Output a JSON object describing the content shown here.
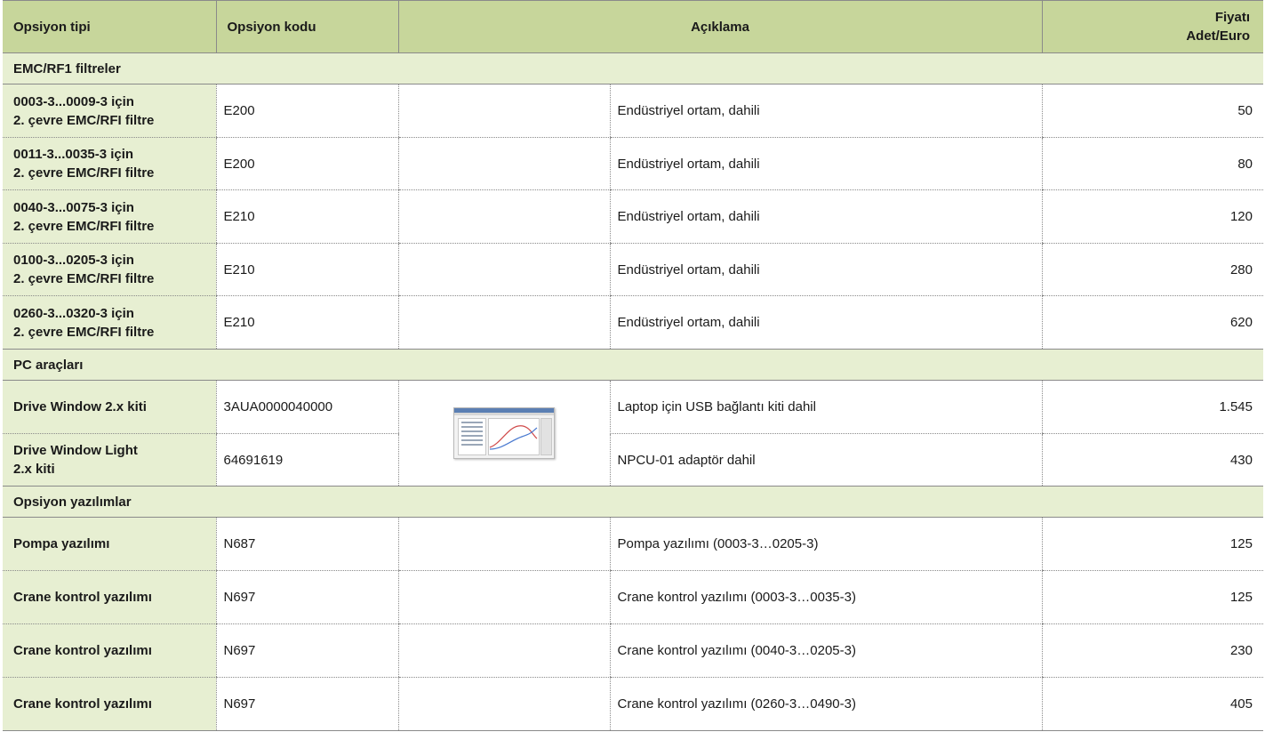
{
  "header": {
    "type": "Opsiyon tipi",
    "code": "Opsiyon kodu",
    "description": "Açıklama",
    "price_line1": "Fiyatı",
    "price_line2": "Adet/Euro"
  },
  "sections": [
    {
      "title": "EMC/RF1 filtreler",
      "rows": [
        {
          "type_line1": "0003-3...0009-3 için",
          "type_line2": "2. çevre EMC/RFI filtre",
          "code": "E200",
          "description": "Endüstriyel ortam, dahili",
          "price": "50"
        },
        {
          "type_line1": "0011-3...0035-3 için",
          "type_line2": "2. çevre EMC/RFI filtre",
          "code": "E200",
          "description": "Endüstriyel ortam, dahili",
          "price": "80"
        },
        {
          "type_line1": "0040-3...0075-3 için",
          "type_line2": "2. çevre EMC/RFI filtre",
          "code": "E210",
          "description": "Endüstriyel ortam, dahili",
          "price": "120"
        },
        {
          "type_line1": "0100-3...0205-3 için",
          "type_line2": "2. çevre EMC/RFI filtre",
          "code": "E210",
          "description": "Endüstriyel ortam, dahili",
          "price": "280"
        },
        {
          "type_line1": "0260-3...0320-3 için",
          "type_line2": "2. çevre EMC/RFI filtre",
          "code": "E210",
          "description": "Endüstriyel ortam, dahili",
          "price": "620"
        }
      ]
    },
    {
      "title": "PC araçları",
      "rows": [
        {
          "type_line1": "Drive Window 2.x kiti",
          "code": "3AUA0000040000",
          "description": "Laptop için USB bağlantı kiti dahil",
          "price": "1.545"
        },
        {
          "type_line1": "Drive Window Light",
          "type_line2": "2.x kiti",
          "code": "64691619",
          "description": "NPCU-01 adaptör dahil",
          "price": "430"
        }
      ],
      "image_icon": "software-screenshot-icon"
    },
    {
      "title": "Opsiyon yazılımlar",
      "rows": [
        {
          "type_line1": "Pompa yazılımı",
          "code": "N687",
          "description": "Pompa yazılımı (0003-3…0205-3)",
          "price": "125"
        },
        {
          "type_line1": "Crane kontrol yazılımı",
          "code": "N697",
          "description": "Crane kontrol yazılımı  (0003-3…0035-3)",
          "price": "125"
        },
        {
          "type_line1": "Crane kontrol yazılımı",
          "code": "N697",
          "description": "Crane kontrol yazılımı  (0040-3…0205-3)",
          "price": "230"
        },
        {
          "type_line1": "Crane kontrol yazılımı",
          "code": "N697",
          "description": "Crane kontrol yazılımı  (0260-3…0490-3)",
          "price": "405"
        }
      ]
    }
  ],
  "colors": {
    "header_bg": "#c7d69b",
    "section_bg": "#e7efd2",
    "type_cell_bg": "#e7efd2",
    "rule": "#8a8a8a"
  }
}
